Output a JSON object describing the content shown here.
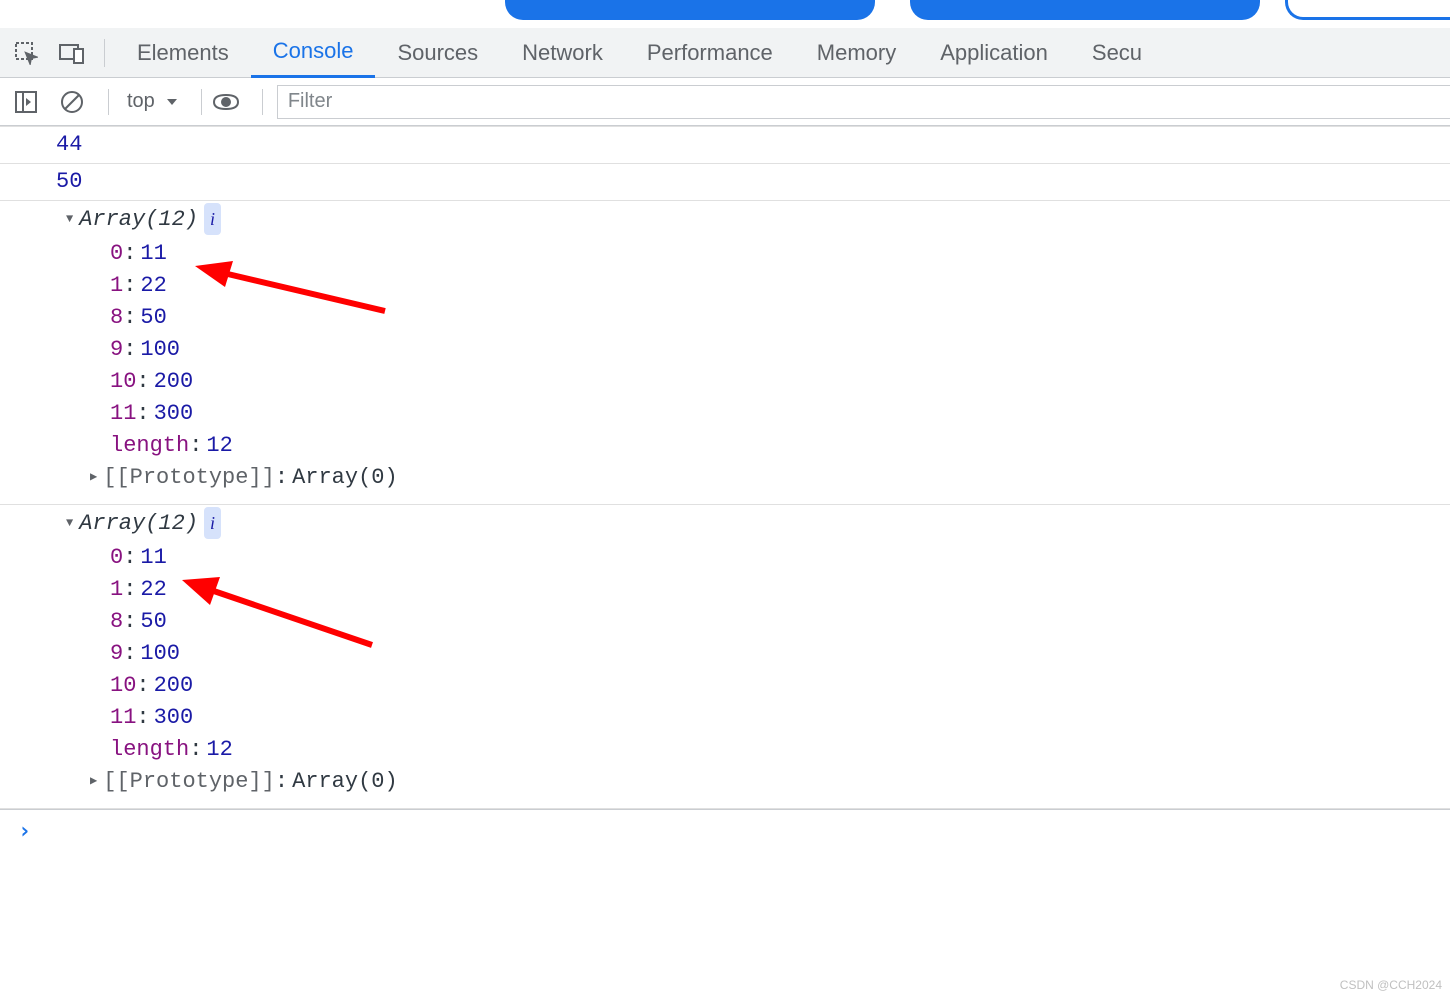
{
  "tabs": {
    "items": [
      "Elements",
      "Console",
      "Sources",
      "Network",
      "Performance",
      "Memory",
      "Application"
    ],
    "last_partial": "Secu",
    "active": "Console"
  },
  "toolbar": {
    "context": "top",
    "filter_placeholder": "Filter"
  },
  "log": {
    "l1": "44",
    "l2": "50",
    "arr1": {
      "head": "Array(12)",
      "rows": [
        {
          "k": "0",
          "v": "11"
        },
        {
          "k": "1",
          "v": "22"
        },
        {
          "k": "8",
          "v": "50"
        },
        {
          "k": "9",
          "v": "100"
        },
        {
          "k": "10",
          "v": "200"
        },
        {
          "k": "11",
          "v": "300"
        }
      ],
      "length_key": "length",
      "length_val": "12",
      "proto_key": "[[Prototype]]",
      "proto_val": "Array(0)"
    },
    "arr2": {
      "head": "Array(12)",
      "rows": [
        {
          "k": "0",
          "v": "11"
        },
        {
          "k": "1",
          "v": "22"
        },
        {
          "k": "8",
          "v": "50"
        },
        {
          "k": "9",
          "v": "100"
        },
        {
          "k": "10",
          "v": "200"
        },
        {
          "k": "11",
          "v": "300"
        }
      ],
      "length_key": "length",
      "length_val": "12",
      "proto_key": "[[Prototype]]",
      "proto_val": "Array(0)"
    },
    "info_symbol": "i",
    "prompt": "›"
  },
  "watermark": "CSDN @CCH2024"
}
